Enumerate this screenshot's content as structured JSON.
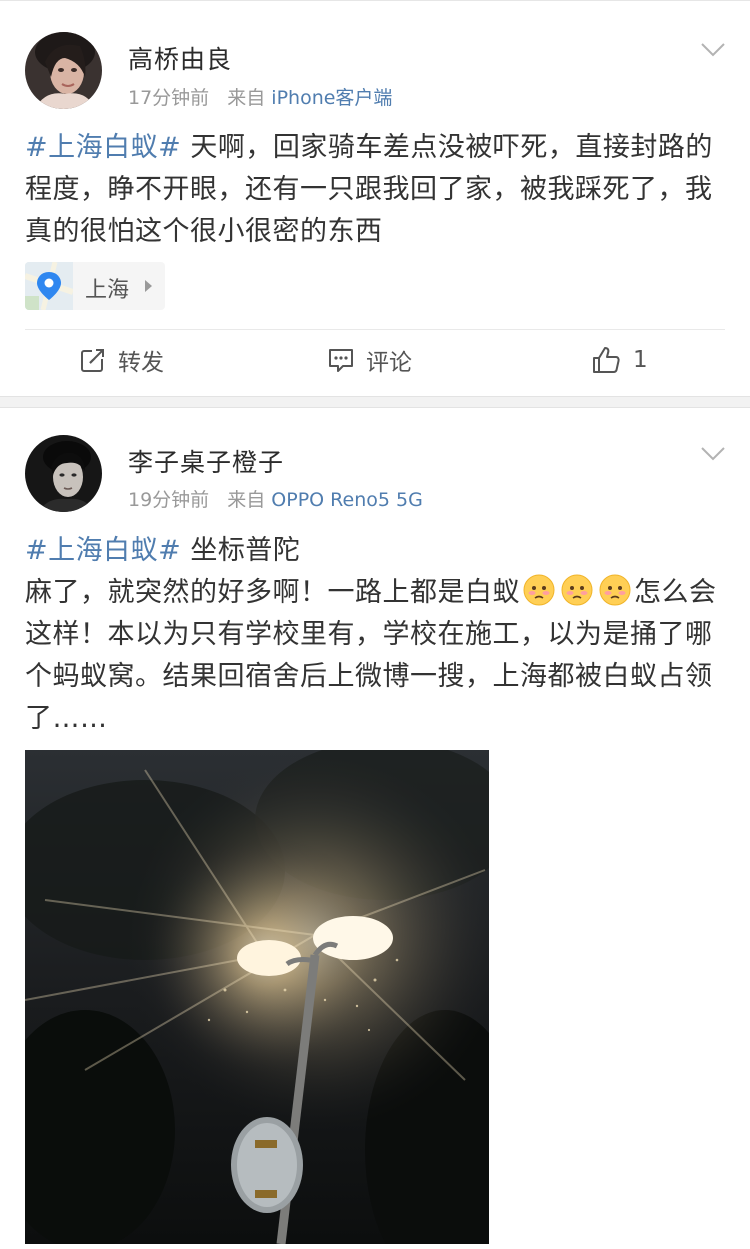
{
  "posts": [
    {
      "username": "高桥由良",
      "time": "17分钟前",
      "from_prefix": "来自",
      "source": "iPhone客户端",
      "hashtag": "#上海白蚁#",
      "text": "天啊，回家骑车差点没被吓死，直接封路的程度，睁不开眼，还有一只跟我回了家，被我踩死了，我真的很怕这个很小很密的东西",
      "location": "上海",
      "actions": {
        "repost_label": "转发",
        "comment_label": "评论",
        "like_count": "1"
      }
    },
    {
      "username": "李子桌子橙子",
      "time": "19分钟前",
      "from_prefix": "来自",
      "source": "OPPO Reno5 5G",
      "hashtag": "#上海白蚁#",
      "title_text": "坐标普陀",
      "line2_a": "麻了，就突然的好多啊！一路上都是白蚁",
      "line2_b": "怎么会这样！本以为只有学校里有，学校在施工，以为是捅了哪个蚂蚁窝。结果回宿舍后上微博一搜，上海都被白蚁占领了……"
    }
  ],
  "colors": {
    "link": "#507daf",
    "meta": "#999999",
    "text": "#333333"
  }
}
